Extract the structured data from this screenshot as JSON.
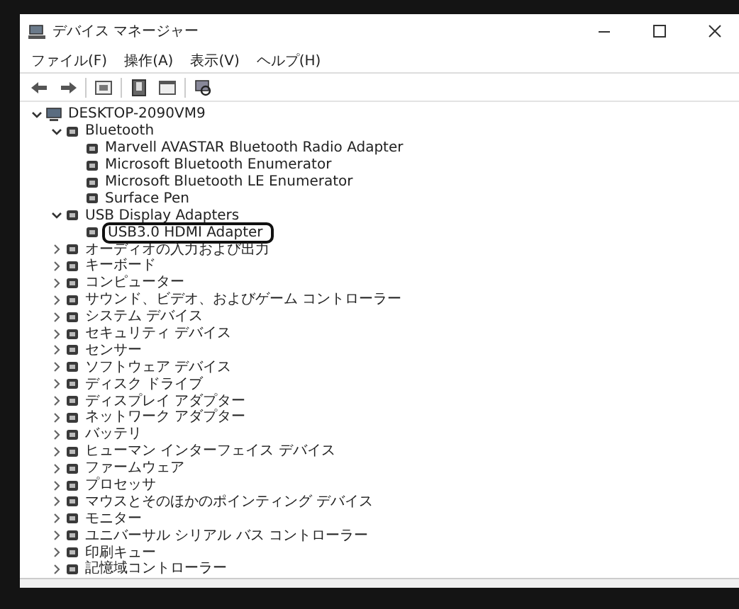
{
  "window": {
    "title": "デバイス マネージャー"
  },
  "menu": [
    "ファイル(F)",
    "操作(A)",
    "表示(V)",
    "ヘルプ(H)"
  ],
  "tree": [
    {
      "label": "DESKTOP-2090VM9",
      "expanded": true,
      "highlighted": false,
      "children": [
        {
          "label": "Bluetooth",
          "expanded": true,
          "highlighted": false,
          "children": [
            {
              "label": "Marvell AVASTAR Bluetooth Radio Adapter",
              "highlighted": false
            },
            {
              "label": "Microsoft Bluetooth Enumerator",
              "highlighted": false
            },
            {
              "label": "Microsoft Bluetooth LE Enumerator",
              "highlighted": false
            },
            {
              "label": "Surface Pen",
              "highlighted": false
            }
          ]
        },
        {
          "label": "USB Display Adapters",
          "expanded": true,
          "highlighted": false,
          "children": [
            {
              "label": "USB3.0 HDMI Adapter",
              "highlighted": true
            }
          ]
        },
        {
          "label": "オーディオの入力および出力",
          "expanded": false,
          "highlighted": false
        },
        {
          "label": "キーボード",
          "expanded": false,
          "highlighted": false
        },
        {
          "label": "コンピューター",
          "expanded": false,
          "highlighted": false
        },
        {
          "label": "サウンド、ビデオ、およびゲーム コントローラー",
          "expanded": false,
          "highlighted": false
        },
        {
          "label": "システム デバイス",
          "expanded": false,
          "highlighted": false
        },
        {
          "label": "セキュリティ デバイス",
          "expanded": false,
          "highlighted": false
        },
        {
          "label": "センサー",
          "expanded": false,
          "highlighted": false
        },
        {
          "label": "ソフトウェア デバイス",
          "expanded": false,
          "highlighted": false
        },
        {
          "label": "ディスク ドライブ",
          "expanded": false,
          "highlighted": false
        },
        {
          "label": "ディスプレイ アダプター",
          "expanded": false,
          "highlighted": false
        },
        {
          "label": "ネットワーク アダプター",
          "expanded": false,
          "highlighted": false
        },
        {
          "label": "バッテリ",
          "expanded": false,
          "highlighted": false
        },
        {
          "label": "ヒューマン インターフェイス デバイス",
          "expanded": false,
          "highlighted": false
        },
        {
          "label": "ファームウェア",
          "expanded": false,
          "highlighted": false
        },
        {
          "label": "プロセッサ",
          "expanded": false,
          "highlighted": false
        },
        {
          "label": "マウスとそのほかのポインティング デバイス",
          "expanded": false,
          "highlighted": false
        },
        {
          "label": "モニター",
          "expanded": false,
          "highlighted": false
        },
        {
          "label": "ユニバーサル シリアル バス コントローラー",
          "expanded": false,
          "highlighted": false
        },
        {
          "label": "印刷キュー",
          "expanded": false,
          "highlighted": false
        },
        {
          "label": "記憶域コントローラー",
          "expanded": false,
          "highlighted": false
        }
      ]
    }
  ]
}
